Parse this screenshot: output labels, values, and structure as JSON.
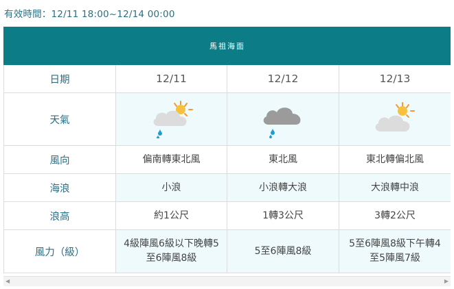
{
  "validity": "有效時間：12/11 18:00~12/14 00:00",
  "table": {
    "title": "馬祖海面",
    "dates_label": "日期",
    "dates": [
      "12/11",
      "12/12",
      "12/13"
    ],
    "weather_label": "天氣",
    "weather_icons": [
      "partly-cloudy-rain-icon",
      "cloudy-rain-icon",
      "partly-cloudy-icon"
    ],
    "wind_dir_label": "風向",
    "wind_dir": [
      "偏南轉東北風",
      "東北風",
      "東北轉偏北風"
    ],
    "waves_label": "海浪",
    "waves": [
      "小浪",
      "小浪轉大浪",
      "大浪轉中浪"
    ],
    "wave_height_label": "浪高",
    "wave_height": [
      "約1公尺",
      "1轉3公尺",
      "3轉2公尺"
    ],
    "wind_force_label": "風力（級）",
    "wind_force": [
      [
        "4級陣風6級以下晚轉5",
        "至6陣風8級"
      ],
      [
        "5至6陣風8級"
      ],
      [
        "5至6陣風8級下午轉4",
        "至5陣風7級"
      ]
    ]
  },
  "colors": {
    "header_bg": "#0c7d86",
    "label_text": "#2a6f85",
    "cell_shade": "#eefafc"
  }
}
